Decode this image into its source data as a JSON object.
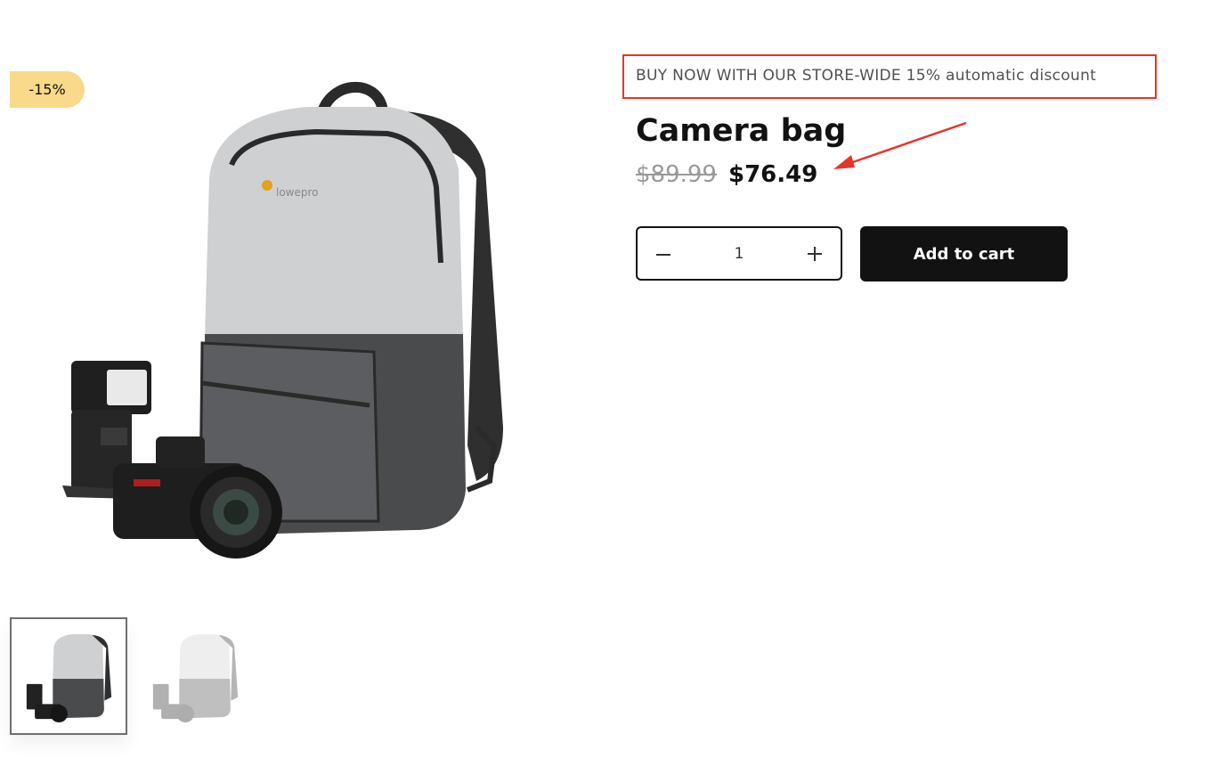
{
  "badge": {
    "label": "-15%"
  },
  "promo": {
    "text": "BUY NOW WITH OUR STORE-WIDE 15% automatic discount"
  },
  "product": {
    "title": "Camera bag",
    "price_original": "$89.99",
    "price_sale": "$76.49"
  },
  "quantity": {
    "value": "1"
  },
  "cart": {
    "add_label": "Add to cart"
  },
  "colors": {
    "badge_bg": "#f9d98a",
    "highlight_red": "#e5352b",
    "button_dark": "#121212",
    "strike_gray": "#9a9a9a"
  },
  "icons": {
    "minus": "minus-icon",
    "plus": "plus-icon",
    "annotation_arrow": "arrow-icon"
  }
}
